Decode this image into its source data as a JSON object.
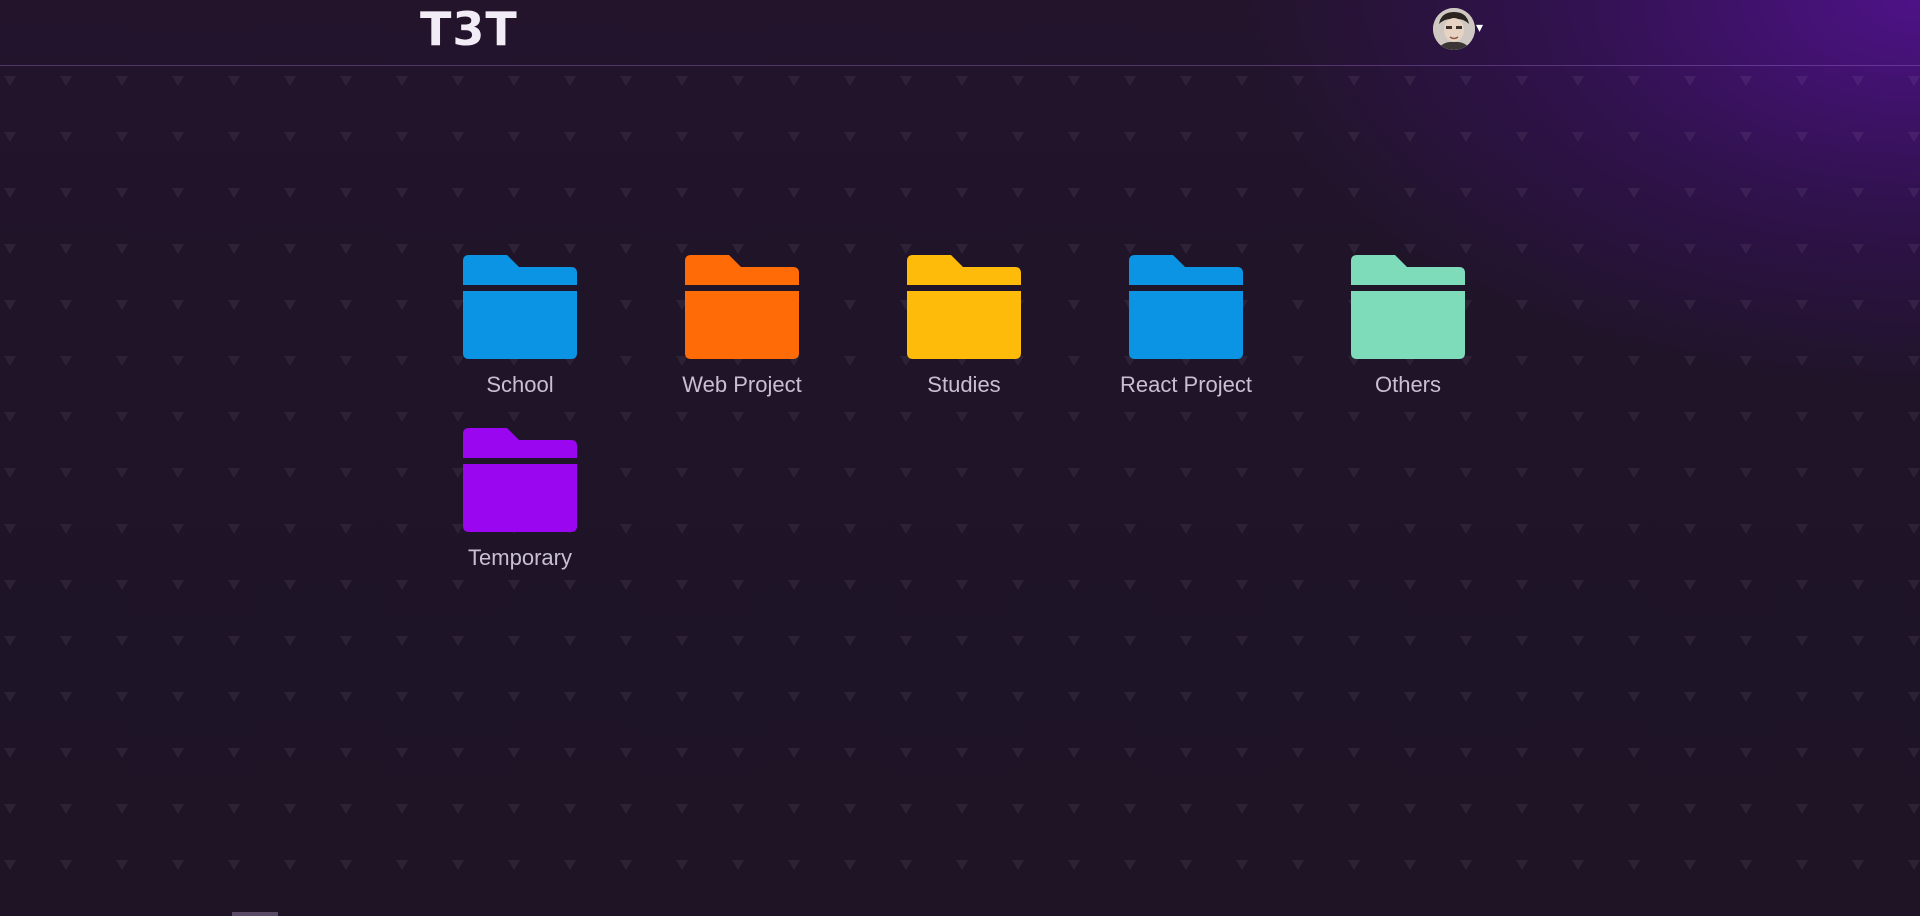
{
  "app": {
    "logo": "T3T"
  },
  "user_menu": {
    "avatar_icon": "user-avatar",
    "caret": "▾"
  },
  "folders": [
    {
      "label": "School",
      "color": "#0b94e3",
      "icon": "folder-icon"
    },
    {
      "label": "Web Project",
      "color": "#ff6b06",
      "icon": "folder-icon"
    },
    {
      "label": "Studies",
      "color": "#ffbb0a",
      "icon": "folder-icon"
    },
    {
      "label": "React Project",
      "color": "#0b94e3",
      "icon": "folder-icon"
    },
    {
      "label": "Others",
      "color": "#7fdcba",
      "icon": "folder-icon"
    },
    {
      "label": "Temporary",
      "color": "#9a06f0",
      "icon": "folder-icon"
    }
  ],
  "theme": {
    "background": "#1f1428",
    "accent": "#4d1285",
    "label_color": "#c9bfd2"
  }
}
